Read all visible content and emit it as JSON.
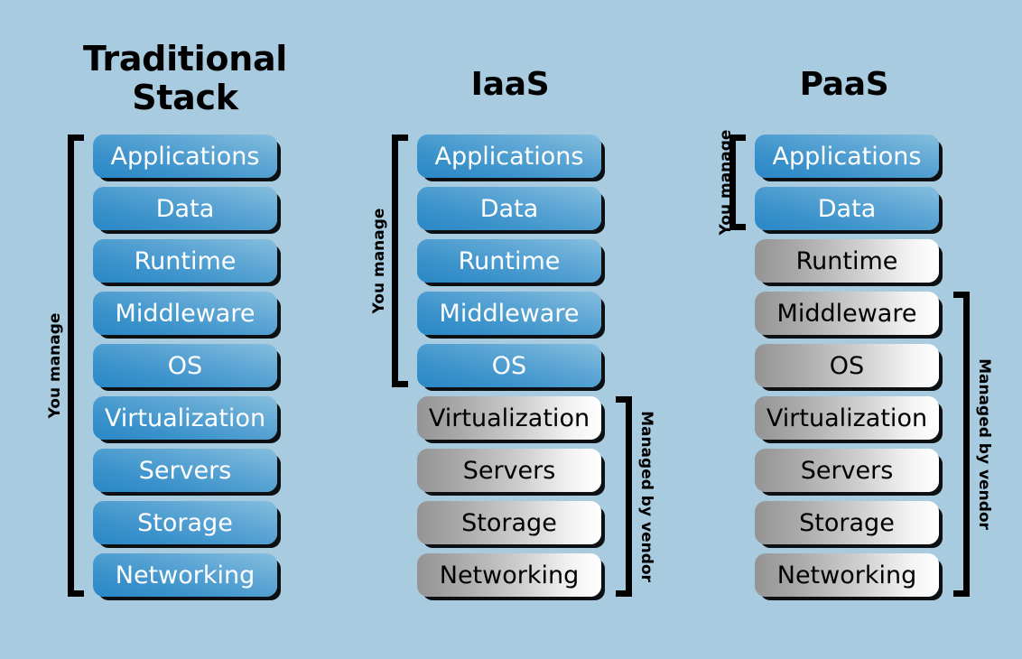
{
  "background_color": "#a8cbe0",
  "palette": {
    "blue_dark": "#2a87c6",
    "blue_light": "#86bede",
    "gray_dark": "#949494",
    "gray_light": "#ffffff",
    "ink": "#000000",
    "blue_text": "#ffffff"
  },
  "columns": [
    {
      "id": "traditional",
      "title": "Traditional\nStack",
      "layers": [
        {
          "label": "Applications",
          "tone": "blue"
        },
        {
          "label": "Data",
          "tone": "blue"
        },
        {
          "label": "Runtime",
          "tone": "blue"
        },
        {
          "label": "Middleware",
          "tone": "blue"
        },
        {
          "label": "OS",
          "tone": "blue"
        },
        {
          "label": "Virtualization",
          "tone": "blue"
        },
        {
          "label": "Servers",
          "tone": "blue"
        },
        {
          "label": "Storage",
          "tone": "blue"
        },
        {
          "label": "Networking",
          "tone": "blue"
        }
      ],
      "brackets": [
        {
          "label": "You manage",
          "side": "left",
          "from": 0,
          "to": 8
        }
      ]
    },
    {
      "id": "iaas",
      "title": "IaaS",
      "layers": [
        {
          "label": "Applications",
          "tone": "blue"
        },
        {
          "label": "Data",
          "tone": "blue"
        },
        {
          "label": "Runtime",
          "tone": "blue"
        },
        {
          "label": "Middleware",
          "tone": "blue"
        },
        {
          "label": "OS",
          "tone": "blue"
        },
        {
          "label": "Virtualization",
          "tone": "gray"
        },
        {
          "label": "Servers",
          "tone": "gray"
        },
        {
          "label": "Storage",
          "tone": "gray"
        },
        {
          "label": "Networking",
          "tone": "gray"
        }
      ],
      "brackets": [
        {
          "label": "You manage",
          "side": "left",
          "from": 0,
          "to": 4
        },
        {
          "label": "Managed by vendor",
          "side": "right",
          "from": 5,
          "to": 8
        }
      ]
    },
    {
      "id": "paas",
      "title": "PaaS",
      "layers": [
        {
          "label": "Applications",
          "tone": "blue"
        },
        {
          "label": "Data",
          "tone": "blue"
        },
        {
          "label": "Runtime",
          "tone": "gray"
        },
        {
          "label": "Middleware",
          "tone": "gray"
        },
        {
          "label": "OS",
          "tone": "gray"
        },
        {
          "label": "Virtualization",
          "tone": "gray"
        },
        {
          "label": "Servers",
          "tone": "gray"
        },
        {
          "label": "Storage",
          "tone": "gray"
        },
        {
          "label": "Networking",
          "tone": "gray"
        }
      ],
      "brackets": [
        {
          "label": "You manage",
          "side": "left",
          "from": 0,
          "to": 1
        },
        {
          "label": "Managed by vendor",
          "side": "right",
          "from": 3,
          "to": 8
        }
      ]
    }
  ]
}
